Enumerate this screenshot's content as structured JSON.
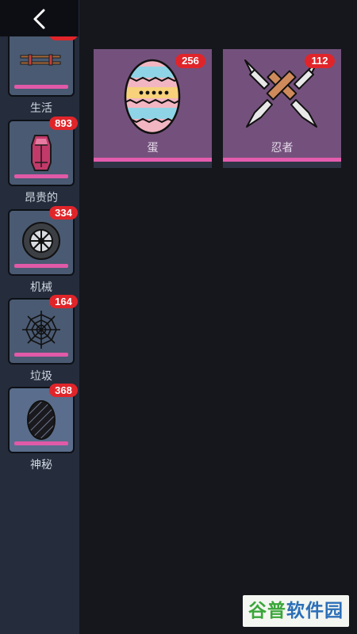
{
  "sidebar": {
    "items": [
      {
        "label": "生活",
        "count": "",
        "icon": "chopsticks-icon"
      },
      {
        "label": "昂贵的",
        "count": "893",
        "icon": "crystal-icon"
      },
      {
        "label": "机械",
        "count": "334",
        "icon": "wheel-icon"
      },
      {
        "label": "垃圾",
        "count": "164",
        "icon": "spiderweb-icon"
      },
      {
        "label": "神秘",
        "count": "368",
        "icon": "mystery-egg-icon"
      }
    ]
  },
  "grid": {
    "items": [
      {
        "label": "蛋",
        "count": "256",
        "icon": "easter-egg-icon"
      },
      {
        "label": "忍者",
        "count": "112",
        "icon": "crossed-knives-icon"
      }
    ]
  },
  "watermark": {
    "part1": "谷普",
    "part2": "软件园"
  },
  "colors": {
    "accent": "#e35cad",
    "badge": "#e0252a",
    "card": "#74517c",
    "sidebar": "#252c3b"
  }
}
